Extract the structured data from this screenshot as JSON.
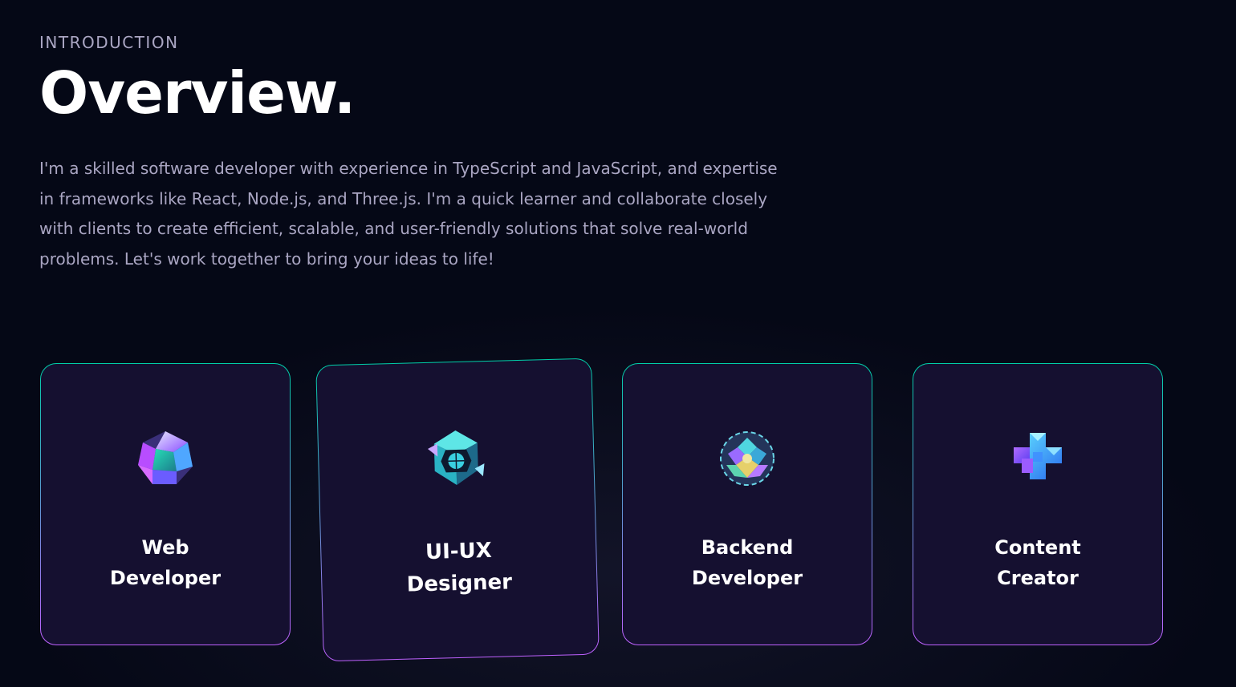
{
  "intro": {
    "subtitle": "INTRODUCTION",
    "title": "Overview.",
    "description": "I'm a skilled software developer with experience in TypeScript and JavaScript, and expertise in frameworks like React, Node.js, and Three.js. I'm a quick learner and collaborate closely with clients to create efficient, scalable, and user-friendly solutions that solve real-world problems. Let's work together to bring your ideas to life!"
  },
  "services": [
    {
      "line1": "Web",
      "line2": "Developer",
      "icon": "crystal-icosahedron-icon"
    },
    {
      "line1": "UI-UX",
      "line2": "Designer",
      "icon": "hexagon-cube-icon"
    },
    {
      "line1": "Backend",
      "line2": "Developer",
      "icon": "faceted-sphere-icon"
    },
    {
      "line1": "Content",
      "line2": "Creator",
      "icon": "cross-blocks-icon"
    }
  ],
  "colors": {
    "background": "#050816",
    "card": "#151030",
    "gradient_top": "#00cea8",
    "gradient_bottom": "#bf61ff",
    "secondary_text": "#aaa6c3"
  }
}
